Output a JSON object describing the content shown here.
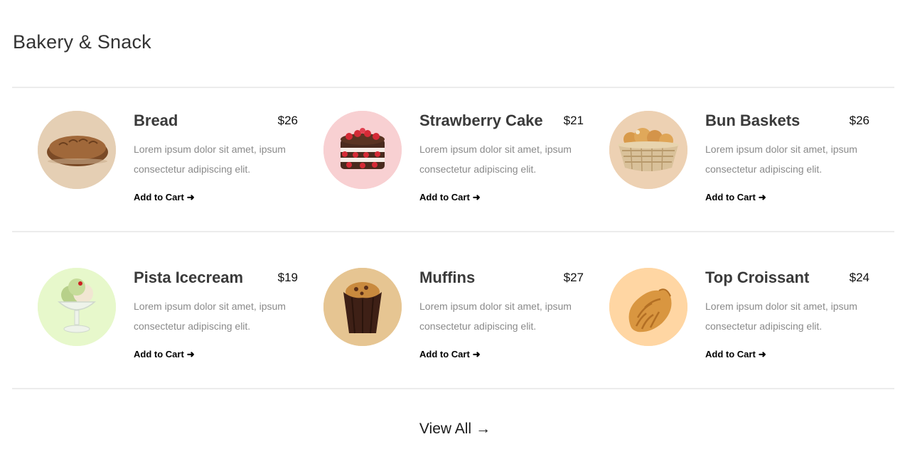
{
  "section": {
    "title": "Bakery & Snack"
  },
  "products": [
    {
      "name": "Bread",
      "price": "$26",
      "description": "Lorem ipsum dolor sit amet, ipsum consectetur adipiscing elit.",
      "cta": "Add to Cart",
      "cta_icon": "➜",
      "icon": "bread-icon",
      "bg": "#e5cfb4"
    },
    {
      "name": "Strawberry Cake",
      "price": "$21",
      "description": "Lorem ipsum dolor sit amet, ipsum consectetur adipiscing elit.",
      "cta": "Add to Cart",
      "cta_icon": "➜",
      "icon": "strawberry-cake-icon",
      "bg": "#f8d0d2"
    },
    {
      "name": "Bun Baskets",
      "price": "$26",
      "description": "Lorem ipsum dolor sit amet, ipsum consectetur adipiscing elit.",
      "cta": "Add to Cart",
      "cta_icon": "➜",
      "icon": "bun-basket-icon",
      "bg": "#edd1b3"
    },
    {
      "name": "Pista Icecream",
      "price": "$19",
      "description": "Lorem ipsum dolor sit amet, ipsum consectetur adipiscing elit.",
      "cta": "Add to Cart",
      "cta_icon": "➜",
      "icon": "icecream-icon",
      "bg": "#e7f8cb"
    },
    {
      "name": "Muffins",
      "price": "$27",
      "description": "Lorem ipsum dolor sit amet, ipsum consectetur adipiscing elit.",
      "cta": "Add to Cart",
      "cta_icon": "➜",
      "icon": "muffin-icon",
      "bg": "#e6c592"
    },
    {
      "name": "Top Croissant",
      "price": "$24",
      "description": "Lorem ipsum dolor sit amet, ipsum consectetur adipiscing elit.",
      "cta": "Add to Cart",
      "cta_icon": "➜",
      "icon": "croissant-icon",
      "bg": "#ffd6a3"
    }
  ],
  "footer": {
    "view_all": "View All",
    "view_all_icon": "→"
  }
}
